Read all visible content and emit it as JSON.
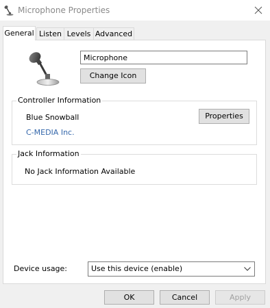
{
  "window": {
    "title": "Microphone Properties"
  },
  "tabs": [
    {
      "label": "General",
      "active": true
    },
    {
      "label": "Listen",
      "active": false
    },
    {
      "label": "Levels",
      "active": false
    },
    {
      "label": "Advanced",
      "active": false
    }
  ],
  "general": {
    "device_name_value": "Microphone",
    "change_icon_label": "Change Icon",
    "controller": {
      "group_title": "Controller Information",
      "device": "Blue Snowball",
      "vendor": "C-MEDIA Inc.",
      "properties_label": "Properties"
    },
    "jack": {
      "group_title": "Jack Information",
      "text": "No Jack Information Available"
    },
    "device_usage": {
      "label": "Device usage:",
      "selected": "Use this device (enable)"
    }
  },
  "buttons": {
    "ok": "OK",
    "cancel": "Cancel",
    "apply": "Apply"
  },
  "icons": {
    "title": "microphone-icon",
    "device": "microphone-icon",
    "close": "close-icon",
    "dropdown": "chevron-down-icon"
  },
  "colors": {
    "link": "#3366aa",
    "disabled_text": "#a0a0a0"
  }
}
